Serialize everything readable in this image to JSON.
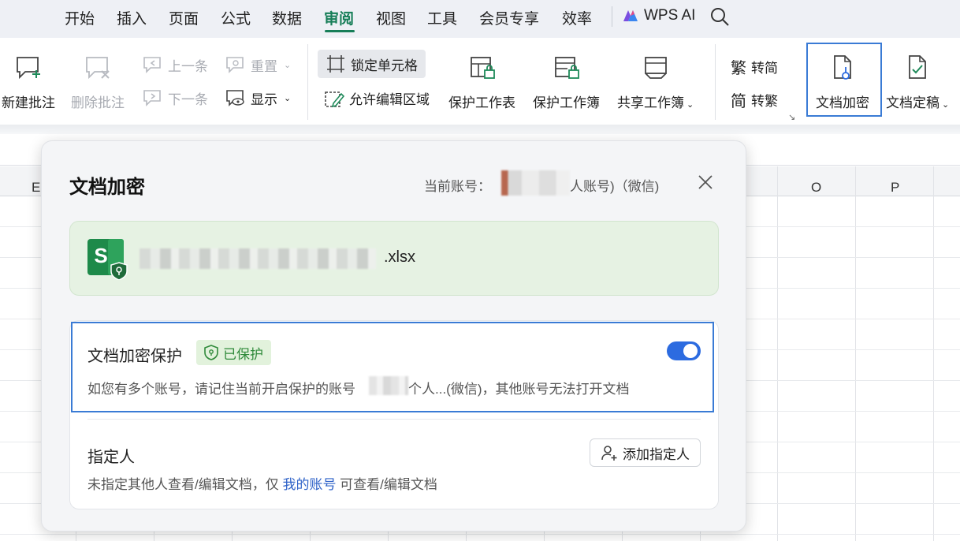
{
  "tabs": [
    {
      "label": "开始",
      "active": false
    },
    {
      "label": "插入",
      "active": false
    },
    {
      "label": "页面",
      "active": false
    },
    {
      "label": "公式",
      "active": false
    },
    {
      "label": "数据",
      "active": false
    },
    {
      "label": "审阅",
      "active": true
    },
    {
      "label": "视图",
      "active": false
    },
    {
      "label": "工具",
      "active": false
    },
    {
      "label": "会员专享",
      "active": false
    },
    {
      "label": "效率",
      "active": false
    }
  ],
  "wps_ai_label": "WPS AI",
  "ribbon": {
    "new_comment": "新建批注",
    "delete_comment": "删除批注",
    "prev_item": "上一条",
    "next_item": "下一条",
    "reset": "重置",
    "show": "显示",
    "lock_cell": "锁定单元格",
    "allow_edit_range": "允许编辑区域",
    "protect_sheet": "保护工作表",
    "protect_workbook": "保护工作簿",
    "share_workbook": "共享工作簿",
    "to_simplified": "转简",
    "to_traditional": "转繁",
    "doc_encrypt": "文档加密",
    "doc_finalize": "文档定稿"
  },
  "sheet": {
    "columns_visible": [
      "E",
      "O",
      "P"
    ]
  },
  "dialog": {
    "title": "文档加密",
    "account_label": "当前账号：",
    "account_suffix": "人账号)（微信)",
    "file_ext": ".xlsx",
    "protection": {
      "title": "文档加密保护",
      "badge": "已保护",
      "enabled": true,
      "desc_before": "如您有多个账号，请记住当前开启保护的账号",
      "desc_after": "个人...(微信)，其他账号无法打开文档"
    },
    "assignee": {
      "title": "指定人",
      "desc_before": "未指定其他人查看/编辑文档，仅 ",
      "desc_link": "我的账号",
      "desc_after": " 可查看/编辑文档",
      "add_button": "添加指定人"
    }
  },
  "colors": {
    "accent_green": "#177e58",
    "toggle_blue": "#2c6be0",
    "highlight_blue": "#3a7bd5",
    "link_blue": "#2e62c8",
    "file_card_bg": "#e6f2e3",
    "badge_green": "#2f8a3a"
  },
  "icons": [
    "wps-ai-logo-icon",
    "search-icon",
    "close-icon",
    "toggle-switch",
    "shield-icon",
    "add-person-icon",
    "spreadsheet-file-icon"
  ]
}
